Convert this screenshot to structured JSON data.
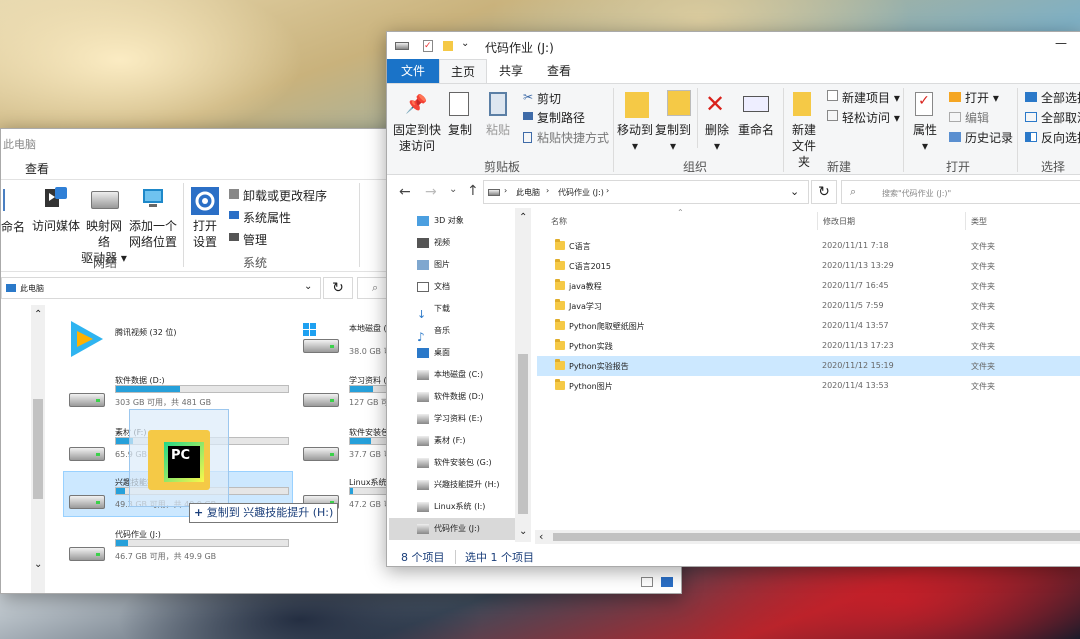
{
  "back_window": {
    "title": "此电脑",
    "view_tab": "查看",
    "ribbon": {
      "rename_partial": "命名",
      "access_media": "访问媒体",
      "map_drive_1": "映射网络",
      "map_drive_2": "驱动器",
      "add_location_1": "添加一个",
      "add_location_2": "网络位置",
      "open_settings_1": "打开",
      "open_settings_2": "设置",
      "uninstall": "卸载或更改程序",
      "system_props": "系统属性",
      "manage": "管理",
      "group_network": "网络",
      "group_system": "系统"
    },
    "address": "此电脑",
    "items": [
      {
        "name": "腾讯视频 (32 位)"
      },
      {
        "name": "本地磁盘 (C:)",
        "info": "38.0 GB 可用，共"
      },
      {
        "name": "软件数据 (D:)",
        "info": "303 GB 可用，共 481 GB",
        "fill": 0.37
      },
      {
        "name": "学习资料 (E:)",
        "info": "127 GB 可用，共",
        "fill": 0.6
      },
      {
        "name": "素材 (F:)",
        "info": "65.9 GB 可用，共",
        "fill": 0.1
      },
      {
        "name": "软件安装包",
        "info": "37.7 GB 可用，共",
        "fill": 0.55
      },
      {
        "name": "兴趣技能提升",
        "info": "49.3 GB 可用，共 49.9 GB",
        "fill": 0.05
      },
      {
        "name": "Linux系统 (I:)",
        "info": "47.2 GB 可用，共",
        "fill": 0.08
      },
      {
        "name": "代码作业 (J:)",
        "info": "46.7 GB 可用，共 49.9 GB",
        "fill": 0.07
      }
    ],
    "drag_tooltip": "复制到 兴趣技能提升 (H:)"
  },
  "front_window": {
    "title": "代码作业 (J:)",
    "tabs": [
      "文件",
      "主页",
      "共享",
      "查看"
    ],
    "ribbon": {
      "pin_1": "固定到快",
      "pin_2": "速访问",
      "copy": "复制",
      "paste": "粘贴",
      "cut": "剪切",
      "copy_path": "复制路径",
      "paste_shortcut": "粘贴快捷方式",
      "group_clipboard": "剪贴板",
      "move_to": "移动到",
      "copy_to": "复制到",
      "delete": "删除",
      "rename": "重命名",
      "group_organize": "组织",
      "new_folder_1": "新建",
      "new_folder_2": "文件夹",
      "new_item": "新建项目",
      "easy_access": "轻松访问",
      "group_new": "新建",
      "properties": "属性",
      "open": "打开",
      "edit": "编辑",
      "history": "历史记录",
      "group_open": "打开",
      "select_all": "全部选择",
      "select_none": "全部取消",
      "invert": "反向选择",
      "group_select": "选择"
    },
    "breadcrumb": [
      "此电脑",
      "代码作业 (J:)"
    ],
    "search_placeholder": "搜索\"代码作业 (J:)\"",
    "nav": [
      "3D 对象",
      "视频",
      "图片",
      "文档",
      "下载",
      "音乐",
      "桌面",
      "本地磁盘 (C:)",
      "软件数据 (D:)",
      "学习资料 (E:)",
      "素材 (F:)",
      "软件安装包 (G:)",
      "兴趣技能提升 (H:)",
      "Linux系统 (I:)",
      "代码作业 (J:)"
    ],
    "columns": {
      "name": "名称",
      "date": "修改日期",
      "type": "类型"
    },
    "files": [
      {
        "name": "C语言",
        "date": "2020/11/11 7:18",
        "type": "文件夹"
      },
      {
        "name": "C语言2015",
        "date": "2020/11/13 13:29",
        "type": "文件夹"
      },
      {
        "name": "java教程",
        "date": "2020/11/7 16:45",
        "type": "文件夹"
      },
      {
        "name": "Java学习",
        "date": "2020/11/5 7:59",
        "type": "文件夹"
      },
      {
        "name": "Python爬取壁纸图片",
        "date": "2020/11/4 13:57",
        "type": "文件夹"
      },
      {
        "name": "Python实践",
        "date": "2020/11/13 17:23",
        "type": "文件夹"
      },
      {
        "name": "Python实验报告",
        "date": "2020/11/12 15:19",
        "type": "文件夹"
      },
      {
        "name": "Python图片",
        "date": "2020/11/4 13:53",
        "type": "文件夹"
      }
    ],
    "status": {
      "count": "8 个项目",
      "selected": "选中 1 个项目"
    }
  }
}
